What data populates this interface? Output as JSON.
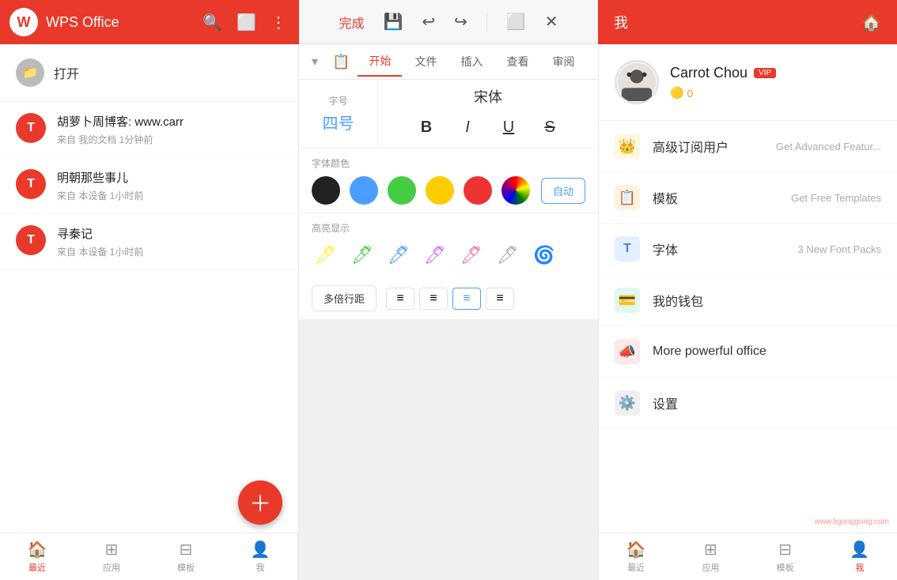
{
  "app": {
    "name": "WPS Office"
  },
  "topbar": {
    "done_label": "完成",
    "section_title": "我"
  },
  "open_btn": {
    "label": "打开"
  },
  "recent_items": [
    {
      "initial": "T",
      "title": "胡萝卜周博客: www.carr",
      "meta": "来自 我的文档  1分钟前"
    },
    {
      "initial": "T",
      "title": "明朝那些事儿",
      "meta": "来自 本设备  1小时前"
    },
    {
      "initial": "T",
      "title": "寻秦记",
      "meta": "来自 本设备  1小时前"
    }
  ],
  "bottom_nav_left": [
    {
      "label": "最近",
      "active": true
    },
    {
      "label": "应用",
      "active": false
    },
    {
      "label": "模板",
      "active": false
    },
    {
      "label": "我",
      "active": false
    }
  ],
  "bottom_nav_right": [
    {
      "label": "最近",
      "active": false
    },
    {
      "label": "应用",
      "active": false
    },
    {
      "label": "模板",
      "active": false
    }
  ],
  "editor_tabs": [
    {
      "label": "开始",
      "active": true
    },
    {
      "label": "文件",
      "active": false
    },
    {
      "label": "插入",
      "active": false
    },
    {
      "label": "查看",
      "active": false
    },
    {
      "label": "审阅",
      "active": false
    }
  ],
  "format": {
    "font_size_label": "字号",
    "font_size_value": "四号",
    "font_family": "宋体",
    "bold": "B",
    "italic": "I",
    "underline": "U",
    "strikethrough": "S",
    "color_label": "字体颜色",
    "highlight_label": "高亮显示",
    "auto_label": "自动",
    "para_label": "多倍行距"
  },
  "user": {
    "name": "Carrot Chou",
    "coins": "0",
    "avatar_emoji": "🧑"
  },
  "menu": [
    {
      "icon": "👑",
      "icon_class": "gold",
      "label": "高级订阅用户",
      "value": "Get Advanced Featur..."
    },
    {
      "icon": "📋",
      "icon_class": "orange",
      "label": "模板",
      "value": "Get Free Templates"
    },
    {
      "icon": "T",
      "icon_class": "blue",
      "label": "字体",
      "value": "3 New Font Packs"
    },
    {
      "icon": "💳",
      "icon_class": "teal",
      "label": "我的钱包",
      "value": ""
    },
    {
      "icon": "📣",
      "icon_class": "red",
      "label": "More powerful office",
      "value": ""
    },
    {
      "icon": "⚙️",
      "icon_class": "gray",
      "label": "设置",
      "value": ""
    }
  ],
  "colors": [
    "#222222",
    "#4a9eff",
    "#44cc44",
    "#ffcc00",
    "#ee3333",
    "#cc44cc"
  ],
  "highlights": [
    "🟡",
    "🟢",
    "🔵",
    "🟣",
    "🔴",
    "⬜",
    "🌀"
  ]
}
